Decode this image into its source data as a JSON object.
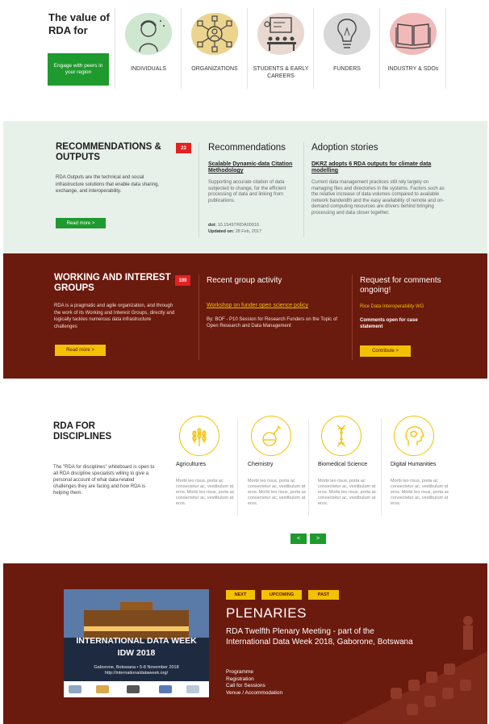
{
  "value_section": {
    "title": "The value of RDA for",
    "engage_button": "Engage with peers in your region",
    "audiences": [
      {
        "label": "INDIVIDUALS",
        "icon": "individual-person-icon",
        "blob_color": "#cfe6cf"
      },
      {
        "label": "ORGANIZATIONS",
        "icon": "organization-network-icon",
        "blob_color": "#ecd48e"
      },
      {
        "label": "STUDENTS & EARLY CAREERS",
        "icon": "classroom-icon",
        "blob_color": "#e9d8cf"
      },
      {
        "label": "FUNDERS",
        "icon": "lightbulb-icon",
        "blob_color": "#d8d8d8"
      },
      {
        "label": "INDUSTRY & SDOs",
        "icon": "open-book-icon",
        "blob_color": "#f2b9b9"
      }
    ]
  },
  "recommendations": {
    "title": "RECOMMENDATIONS & OUTPUTS",
    "description": "RDA Outputs are the technical and social infrastructure solutions that enable data sharing, exchange, and interoperability.",
    "read_more": "Read more  >",
    "count": "23",
    "column1": {
      "heading": "Recommendations",
      "link": "Scalable Dynamic-data Citation Methodology",
      "body": "Supporting accurate citation of data subjected to change, for the efficient processing of data and linking from publications.",
      "doi_label": "doi:",
      "doi": "10.15497/RDA00016",
      "updated_label": "Updated on:",
      "updated": "28 Feb, 2017"
    },
    "column2": {
      "heading": "Adoption stories",
      "link": "DKRZ adopts 6 RDA outputs for climate data modelling",
      "body": "Current data management practices still rely largely on managing files and directories in file systems. Factors such as the relative increase of data volumes compared to available network bandwidth and the easy availability of remote and on-demand computing resources are drivers behind bringing processing and data closer together."
    }
  },
  "groups": {
    "title": "WORKING AND INTEREST GROUPS",
    "description": "RDA is a pragmatic and agile organization, and through the work of its Working and Interest Groups, directly and logically tackles numerous data infrastructure challenges",
    "read_more": "Read more  >",
    "count": "100",
    "activity": {
      "heading": "Recent group activity",
      "link": "Workshop on funder open science policy",
      "body": "By: BOF - P10 Session for Research Funders on the Topic of Open Research and Data Management"
    },
    "comments": {
      "heading": "Request for comments  ongoing!",
      "link": "Rice Data Interoperability WG",
      "body": "Comments open for case statement",
      "button": "Contribute  >"
    }
  },
  "disciplines": {
    "title": "RDA FOR DISCIPLINES",
    "description": "The \"RDA for disciplines\" whiteboard is open to all RDA discipline specialists willing to give a personal account of what data-related challenges they are facing and how RDA is helping them.",
    "items": [
      {
        "name": "Agricultures",
        "icon": "wheat-icon",
        "text": "Morbi leo risus, porta ac consectetur ac, vestibulum at eros. Morbi leo risus, porta ac consectetur ac, vestibulum at eros."
      },
      {
        "name": "Chemistry",
        "icon": "flask-icon",
        "text": "Morbi leo risus, porta ac consectetur ac, vestibulum at eros. Morbi leo risus, porta ac consectetur ac, vestibulum at eros."
      },
      {
        "name": "Biomedical Science",
        "icon": "dna-icon",
        "text": "Morbi leo risus, porta ac consectetur ac, vestibulum at eros. Morbi leo risus, porta ac consectetur ac, vestibulum at eros."
      },
      {
        "name": "Digital Humanities",
        "icon": "head-profile-icon",
        "text": "Morbi leo risus, porta ac consectetur ac, vestibulum at eros. Morbi leo risus, porta ac consectetur ac, vestibulum at eros."
      }
    ],
    "prev": "<",
    "next": ">"
  },
  "plenaries": {
    "tabs": [
      "NEXT",
      "UPCOMING",
      "PAST"
    ],
    "title": "PLENARIES",
    "subtitle": "RDA Twelfth Plenary Meeting - part of the International Data Week 2018, Gaborone, Botswana",
    "links": [
      "Programme",
      "Registration",
      "Call for Sessions",
      "Venue / Accommodation"
    ],
    "banner": {
      "line1": "INTERNATIONAL DATA WEEK",
      "line2": "IDW 2018",
      "line3": "Gaborone, Botswana • 5-8 November 2018",
      "line4": "http://internationaldataweek.org/"
    }
  },
  "colors": {
    "green": "#1f9a2e",
    "maroon": "#6b1a0e",
    "yellow": "#f2c100",
    "red_badge": "#e32222",
    "mint_bg": "#e8f0ea"
  }
}
